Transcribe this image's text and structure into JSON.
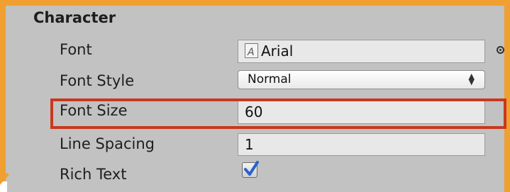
{
  "section": {
    "title": "Character"
  },
  "rows": {
    "font": {
      "label": "Font",
      "value": "Arial"
    },
    "font_style": {
      "label": "Font Style",
      "value": "Normal"
    },
    "font_size": {
      "label": "Font Size",
      "value": "60"
    },
    "line_spacing": {
      "label": "Line Spacing",
      "value": "1"
    },
    "rich_text": {
      "label": "Rich Text",
      "checked": true
    }
  },
  "colors": {
    "panel_background": "#c2c2c2",
    "outer_border": "#f0a030",
    "highlight_border": "#c8381e",
    "checkmark": "#2a62c9"
  },
  "icons": {
    "font_asset": "font-asset-icon",
    "object_picker": "object-picker-icon",
    "dropdown_arrows": "up-down-arrows-icon",
    "checkmark": "checkmark-icon"
  }
}
